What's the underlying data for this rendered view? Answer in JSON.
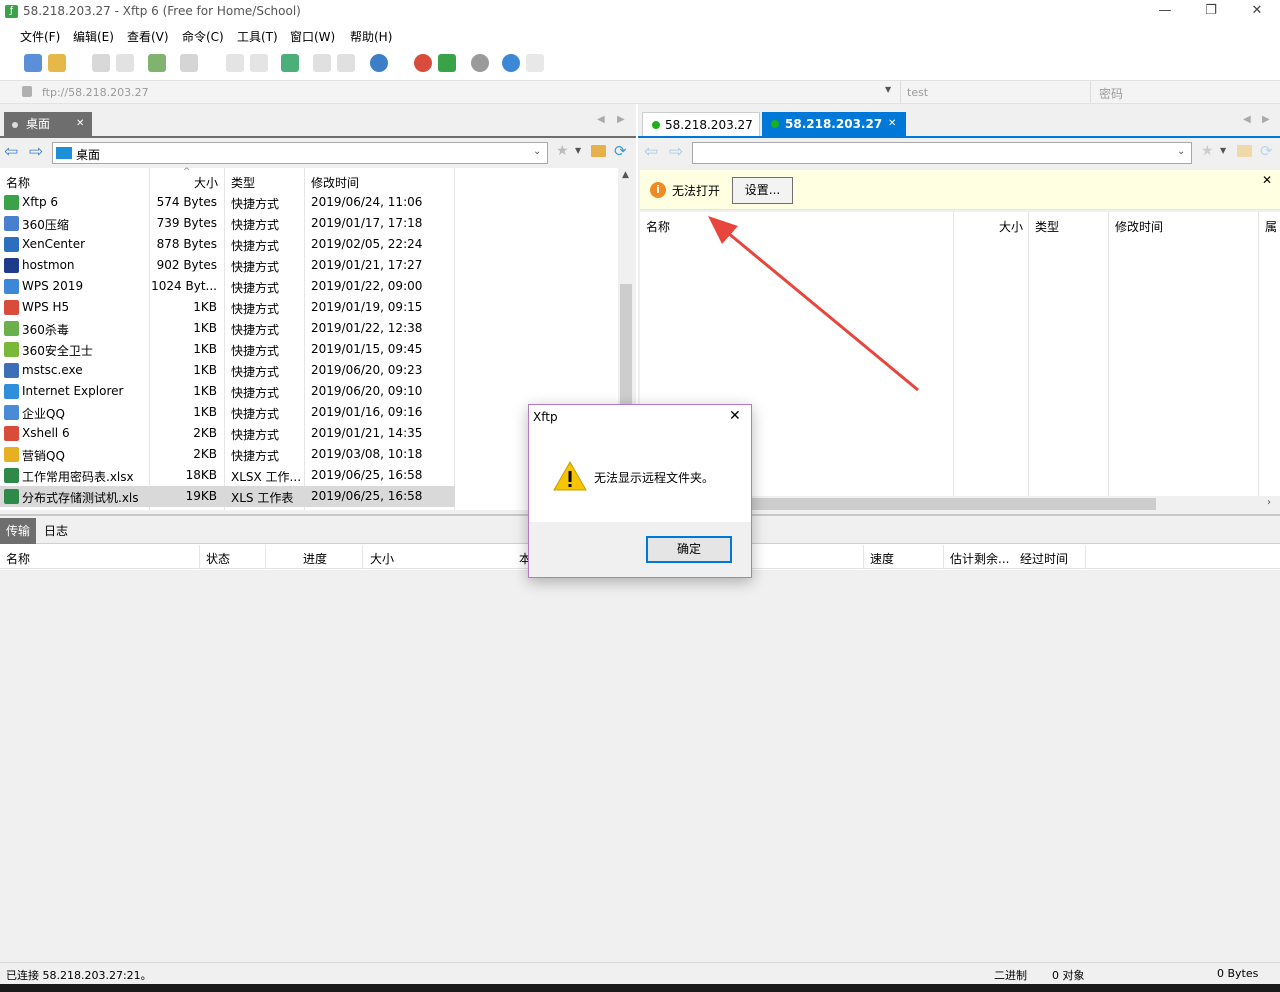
{
  "window": {
    "title": "58.218.203.27    - Xftp 6 (Free for Home/School)",
    "min_glyph": "—",
    "max_glyph": "❐",
    "close_glyph": "✕"
  },
  "menu": [
    "文件(F)",
    "编辑(E)",
    "查看(V)",
    "命令(C)",
    "工具(T)",
    "窗口(W)",
    "帮助(H)"
  ],
  "address": {
    "url": "ftp://58.218.203.27",
    "user": "test",
    "password_placeholder": "密码"
  },
  "left_pane": {
    "tab_label": "桌面",
    "path": "桌面",
    "columns": {
      "name": "名称",
      "size": "大小",
      "type": "类型",
      "modified": "修改时间"
    },
    "files": [
      {
        "name": "Xftp 6",
        "size": "574 Bytes",
        "type": "快捷方式",
        "modified": "2019/06/24, 11:06",
        "icon": "xftp-icon"
      },
      {
        "name": "360压缩",
        "size": "739 Bytes",
        "type": "快捷方式",
        "modified": "2019/01/17, 17:18",
        "icon": "360zip-icon"
      },
      {
        "name": "XenCenter",
        "size": "878 Bytes",
        "type": "快捷方式",
        "modified": "2019/02/05, 22:24",
        "icon": "xencenter-icon"
      },
      {
        "name": "hostmon",
        "size": "902 Bytes",
        "type": "快捷方式",
        "modified": "2019/01/21, 17:27",
        "icon": "hostmon-icon"
      },
      {
        "name": "WPS 2019",
        "size": "1024 Byt...",
        "type": "快捷方式",
        "modified": "2019/01/22, 09:00",
        "icon": "wps-icon"
      },
      {
        "name": "WPS H5",
        "size": "1KB",
        "type": "快捷方式",
        "modified": "2019/01/19, 09:15",
        "icon": "wps-h5-icon"
      },
      {
        "name": "360杀毒",
        "size": "1KB",
        "type": "快捷方式",
        "modified": "2019/01/22, 12:38",
        "icon": "360-antivirus-icon"
      },
      {
        "name": "360安全卫士",
        "size": "1KB",
        "type": "快捷方式",
        "modified": "2019/01/15, 09:45",
        "icon": "360-safe-icon"
      },
      {
        "name": "mstsc.exe",
        "size": "1KB",
        "type": "快捷方式",
        "modified": "2019/06/20, 09:23",
        "icon": "mstsc-icon"
      },
      {
        "name": "Internet Explorer",
        "size": "1KB",
        "type": "快捷方式",
        "modified": "2019/06/20, 09:10",
        "icon": "ie-icon"
      },
      {
        "name": "企业QQ",
        "size": "1KB",
        "type": "快捷方式",
        "modified": "2019/01/16, 09:16",
        "icon": "qq-enterprise-icon"
      },
      {
        "name": "Xshell 6",
        "size": "2KB",
        "type": "快捷方式",
        "modified": "2019/01/21, 14:35",
        "icon": "xshell-icon"
      },
      {
        "name": "营销QQ",
        "size": "2KB",
        "type": "快捷方式",
        "modified": "2019/03/08, 10:18",
        "icon": "qq-marketing-icon"
      },
      {
        "name": "工作常用密码表.xlsx",
        "size": "18KB",
        "type": "XLSX 工作...",
        "modified": "2019/06/25, 16:58",
        "icon": "xlsx-file-icon"
      },
      {
        "name": "分布式存储测试机.xls",
        "size": "19KB",
        "type": "XLS 工作表",
        "modified": "2019/06/25, 16:58",
        "icon": "xls-file-icon"
      }
    ]
  },
  "right_pane": {
    "tab1_label": "58.218.203.27",
    "tab2_label": "58.218.203.27",
    "info_text": "无法打开",
    "settings_button": "设置...",
    "columns": {
      "name": "名称",
      "size": "大小",
      "type": "类型",
      "modified": "修改时间",
      "attr": "属"
    }
  },
  "transfer": {
    "tab_transfer": "传输",
    "tab_log": "日志",
    "columns": {
      "name": "名称",
      "status": "状态",
      "progress": "进度",
      "size": "大小",
      "local": "本",
      "speed": "速度",
      "eta": "估计剩余...",
      "elapsed": "经过时间"
    }
  },
  "dialog": {
    "title": "Xftp",
    "message": "无法显示远程文件夹。",
    "ok_button": "确定"
  },
  "status_bar": {
    "connection": "已连接 58.218.203.27:21。",
    "mode": "二进制",
    "objects": "0 对象",
    "bytes": "0 Bytes"
  },
  "colors": {
    "accent_tab": "#0078d7",
    "connected_dot": "#19b219",
    "arrow": "#e8453c",
    "info_bar": "#ffffe1"
  }
}
